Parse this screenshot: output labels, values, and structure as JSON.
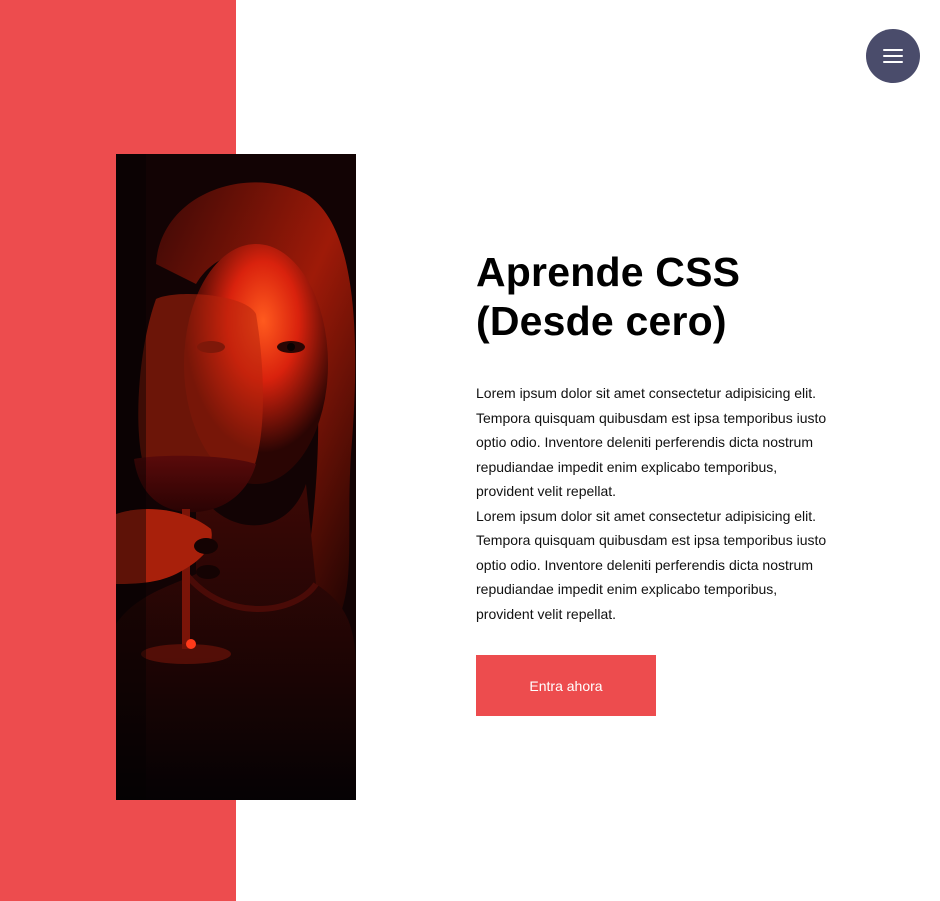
{
  "menu": {
    "icon": "hamburger-menu-icon"
  },
  "hero": {
    "image": "woman-holding-wine-glass-photo",
    "title_line1": "Aprende CSS",
    "title_line2": "(Desde cero)",
    "paragraphs": [
      "Lorem ipsum dolor sit amet consectetur adipisicing elit. Tempora quisquam quibusdam est ipsa temporibus iusto optio odio. Inventore deleniti perferendis dicta nostrum repudiandae impedit enim explicabo temporibus, provident velit repellat.",
      "Lorem ipsum dolor sit amet consectetur adipisicing elit. Tempora quisquam quibusdam est ipsa temporibus iusto optio odio. Inventore deleniti perferendis dicta nostrum repudiandae impedit enim explicabo temporibus, provident velit repellat."
    ],
    "cta_label": "Entra ahora"
  },
  "colors": {
    "accent": "#ed4c4e",
    "menu_button": "#4a4c6b",
    "background": "#ffffff",
    "text": "#000000"
  }
}
